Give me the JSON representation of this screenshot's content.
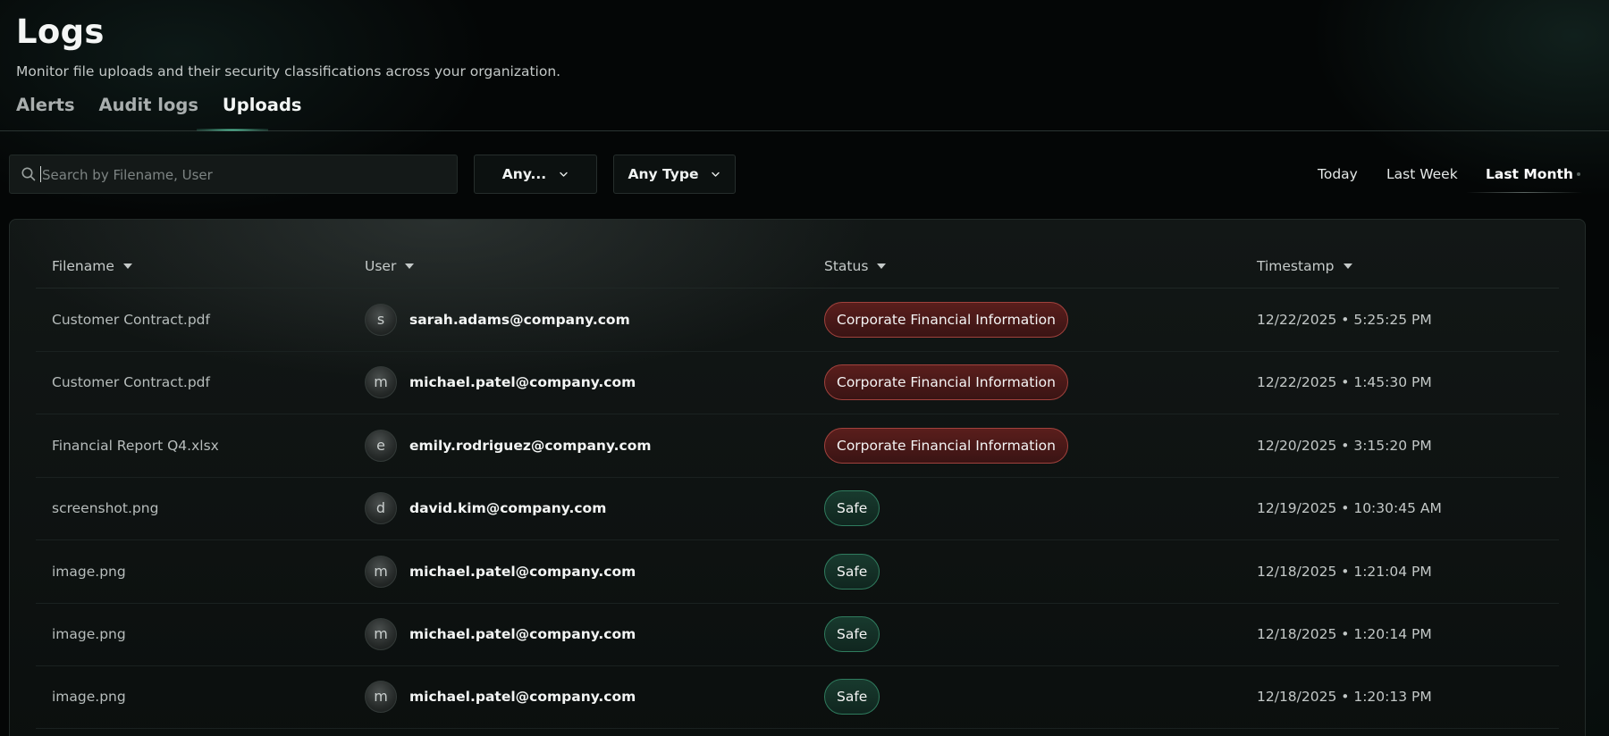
{
  "header": {
    "title": "Logs",
    "subtitle": "Monitor file uploads and their security classifications across your organization.",
    "tabs": [
      {
        "label": "Alerts",
        "active": false
      },
      {
        "label": "Audit logs",
        "active": false
      },
      {
        "label": "Uploads",
        "active": true
      }
    ]
  },
  "filters": {
    "search_placeholder": "Search by Filename, User",
    "search_value": "",
    "user_filter": "Any...",
    "type_filter": "Any Type",
    "ranges": [
      {
        "label": "Today",
        "active": false
      },
      {
        "label": "Last Week",
        "active": false
      },
      {
        "label": "Last Month",
        "active": true
      }
    ]
  },
  "table": {
    "columns": [
      "Filename",
      "User",
      "Status",
      "Timestamp"
    ],
    "rows": [
      {
        "filename": "Customer Contract.pdf",
        "initial": "s",
        "user": "sarah.adams@company.com",
        "status": "Corporate Financial Information",
        "status_kind": "danger",
        "timestamp": "12/22/2025 • 5:25:25 PM"
      },
      {
        "filename": "Customer Contract.pdf",
        "initial": "m",
        "user": "michael.patel@company.com",
        "status": "Corporate Financial Information",
        "status_kind": "danger",
        "timestamp": "12/22/2025 • 1:45:30 PM"
      },
      {
        "filename": "Financial Report Q4.xlsx",
        "initial": "e",
        "user": "emily.rodriguez@company.com",
        "status": "Corporate Financial Information",
        "status_kind": "danger",
        "timestamp": "12/20/2025 • 3:15:20 PM"
      },
      {
        "filename": "screenshot.png",
        "initial": "d",
        "user": "david.kim@company.com",
        "status": "Safe",
        "status_kind": "safe",
        "timestamp": "12/19/2025 • 10:30:45 AM"
      },
      {
        "filename": "image.png",
        "initial": "m",
        "user": "michael.patel@company.com",
        "status": "Safe",
        "status_kind": "safe",
        "timestamp": "12/18/2025 • 1:21:04 PM"
      },
      {
        "filename": "image.png",
        "initial": "m",
        "user": "michael.patel@company.com",
        "status": "Safe",
        "status_kind": "safe",
        "timestamp": "12/18/2025 • 1:20:14 PM"
      },
      {
        "filename": "image.png",
        "initial": "m",
        "user": "michael.patel@company.com",
        "status": "Safe",
        "status_kind": "safe",
        "timestamp": "12/18/2025 • 1:20:13 PM"
      }
    ]
  },
  "colors": {
    "accent": "#5fd6ad",
    "danger_border": "#a1423d",
    "safe_border": "#2f7c5e"
  }
}
